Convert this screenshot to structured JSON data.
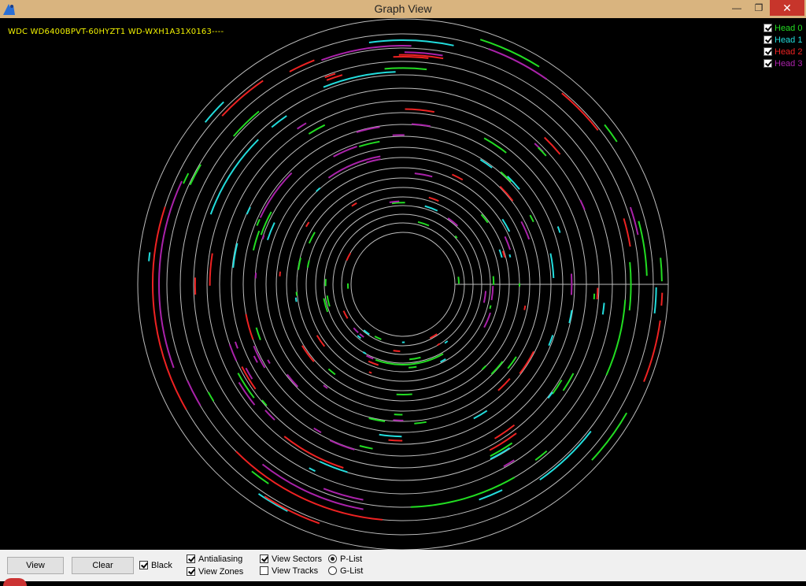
{
  "window": {
    "title": "Graph View",
    "minimize": "—",
    "maximize": "❐",
    "close": "✕"
  },
  "drive_label": "WDC WD6400BPVT-60HYZT1 WD-WXH1A31X0163----",
  "legend": [
    {
      "label": "Head 0",
      "color": "#22dd22",
      "checked": true
    },
    {
      "label": "Head 1",
      "color": "#22dddd",
      "checked": true
    },
    {
      "label": "Head 2",
      "color": "#ee2222",
      "checked": true
    },
    {
      "label": "Head 3",
      "color": "#aa22aa",
      "checked": true
    }
  ],
  "controls": {
    "view_button": "View",
    "clear_button": "Clear",
    "black": {
      "label": "Black",
      "checked": true
    },
    "antialiasing": {
      "label": "Antialiasing",
      "checked": true
    },
    "view_zones": {
      "label": "View Zones",
      "checked": true
    },
    "view_sectors": {
      "label": "View Sectors",
      "checked": true
    },
    "view_tracks": {
      "label": "View Tracks",
      "checked": false
    },
    "plist": {
      "label": "P-List",
      "selected": true
    },
    "glist": {
      "label": "G-List",
      "selected": false
    }
  },
  "colors": {
    "head0": "#22dd22",
    "head1": "#22dddd",
    "head2": "#ee2222",
    "head3": "#aa22aa",
    "zone_ring": "#bdbdbd",
    "background": "#000000"
  }
}
